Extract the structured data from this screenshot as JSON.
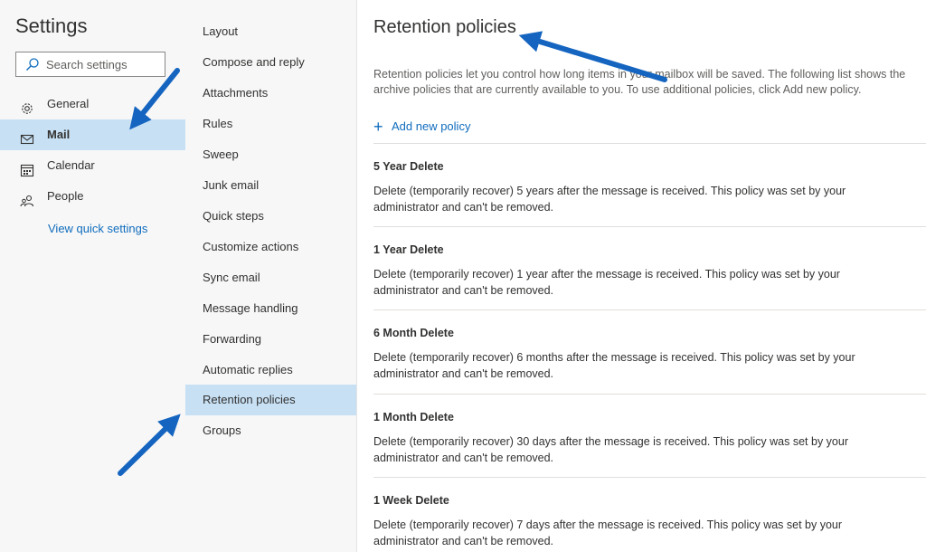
{
  "settings": {
    "title": "Settings",
    "search_placeholder": "Search settings"
  },
  "nav": {
    "items": [
      {
        "label": "General",
        "icon": "gear-icon"
      },
      {
        "label": "Mail",
        "icon": "mail-icon",
        "selected": true
      },
      {
        "label": "Calendar",
        "icon": "calendar-icon"
      },
      {
        "label": "People",
        "icon": "people-icon"
      }
    ],
    "quick_settings_link": "View quick settings"
  },
  "mail_menu": {
    "items": [
      "Layout",
      "Compose and reply",
      "Attachments",
      "Rules",
      "Sweep",
      "Junk email",
      "Quick steps",
      "Customize actions",
      "Sync email",
      "Message handling",
      "Forwarding",
      "Automatic replies",
      "Retention policies",
      "Groups"
    ],
    "selected": "Retention policies"
  },
  "content": {
    "title": "Retention policies",
    "description_line1": "Retention policies let you control how long items in your mailbox will be saved. The following list shows the",
    "description_line2": "archive policies that are currently available to you. To use additional policies, click Add new policy.",
    "add_policy_label": "Add new policy",
    "policies": [
      {
        "name": "5 Year Delete",
        "description": "Delete (temporarily recover) 5 years after the message is received. This policy was set by your administrator and can't be removed."
      },
      {
        "name": "1 Year Delete",
        "description": "Delete (temporarily recover) 1 year after the message is received. This policy was set by your administrator and can't be removed."
      },
      {
        "name": "6 Month Delete",
        "description": "Delete (temporarily recover) 6 months after the message is received. This policy was set by your administrator and can't be removed."
      },
      {
        "name": "1 Month Delete",
        "description": "Delete (temporarily recover) 30 days after the message is received. This policy was set by your administrator and can't be removed."
      },
      {
        "name": "1 Week Delete",
        "description": "Delete (temporarily recover) 7 days after the message is received. This policy was set by your administrator and can't be removed."
      }
    ]
  },
  "colors": {
    "accent": "#0f6cbd",
    "selected_bg": "#c7e0f4",
    "pane_bg": "#f7f7f7",
    "arrow": "#1565c0"
  }
}
